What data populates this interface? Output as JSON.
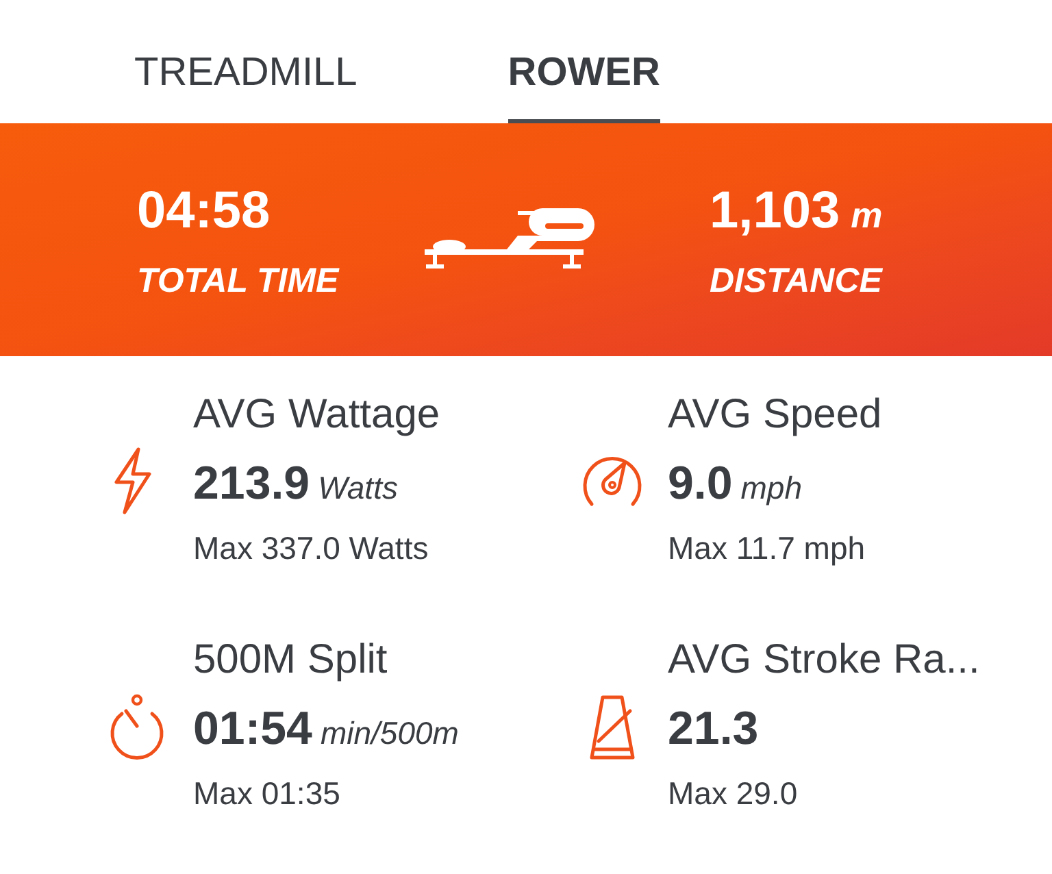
{
  "tabs": [
    {
      "label": "TREADMILL",
      "selected": false
    },
    {
      "label": "ROWER",
      "selected": true
    }
  ],
  "summary": [
    {
      "value": "04:58",
      "label": "TOTAL TIME"
    },
    {
      "value": "1,103",
      "unit": "m",
      "label": "DISTANCE"
    }
  ],
  "stats": [
    {
      "kind": "power",
      "label": "AVG Wattage",
      "value": "213.9",
      "unit": "Watts",
      "max": "Max 337.0 Watts"
    },
    {
      "kind": "speed",
      "label": "AVG Speed",
      "value": "9.0",
      "unit": "mph",
      "max": "Max 11.7 mph"
    },
    {
      "kind": "split",
      "label": "500M Split",
      "value": "01:54",
      "unit": "min/500m",
      "max": "Max 01:35"
    },
    {
      "kind": "rate",
      "label": "AVG Stroke Ra...",
      "value": "21.3",
      "max": "Max 29.0"
    }
  ]
}
